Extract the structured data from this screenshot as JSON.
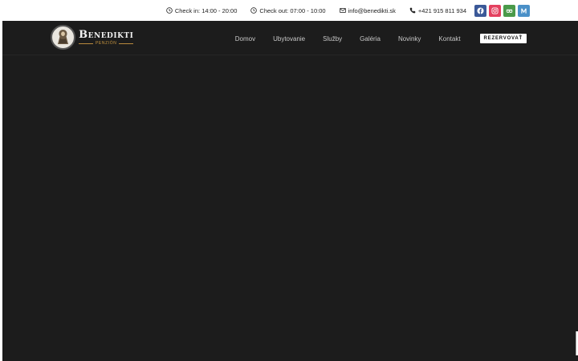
{
  "topbar": {
    "checkin": "Check in: 14:00 - 20:00",
    "checkout": "Check out: 07:00 - 10:00",
    "email": "info@benedikti.sk",
    "phone": "+421 915 811 934",
    "social": [
      {
        "name": "facebook-icon",
        "color": "#3b5998"
      },
      {
        "name": "instagram-icon",
        "color": "#e4405f"
      },
      {
        "name": "tripadvisor-icon",
        "color": "#4a9a4a"
      },
      {
        "name": "m-icon",
        "color": "#4a90c8"
      }
    ]
  },
  "logo": {
    "name": "Benedikti",
    "sub": "PENZIÓN"
  },
  "nav": {
    "items": [
      "Domov",
      "Ubytovanie",
      "Služby",
      "Galéria",
      "Novinky",
      "Kontakt"
    ],
    "cta": "REZERVOVAŤ"
  },
  "colors": {
    "dark_bg": "#1c1c1c",
    "accent_gold": "#c9963f"
  }
}
